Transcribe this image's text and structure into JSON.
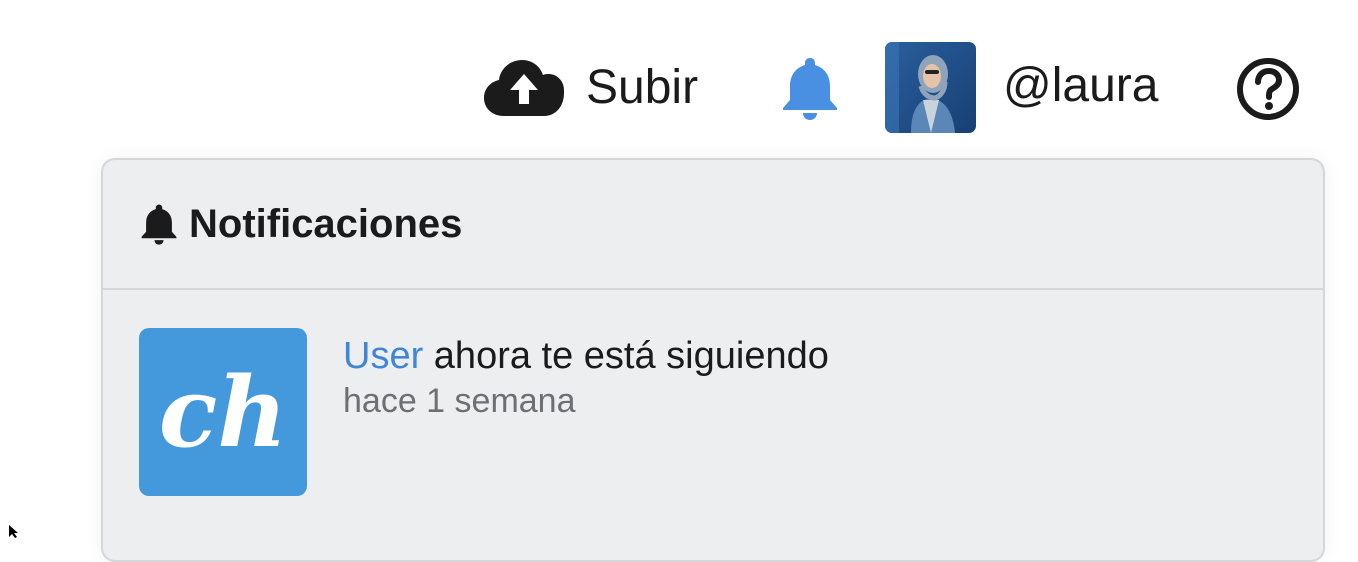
{
  "topbar": {
    "upload_label": "Subir",
    "username": "@laura",
    "icons": {
      "upload": "cloud-upload-icon",
      "notifications": "bell-icon",
      "help": "question-circle-icon"
    }
  },
  "notifications": {
    "title": "Notificaciones",
    "items": [
      {
        "user": "User",
        "message": "ahora te está siguiendo",
        "time": "hace 1 semana",
        "logo_text": "ch"
      }
    ]
  },
  "colors": {
    "accent": "#4a90e2",
    "link": "#3f86d6",
    "logo_bg": "#4499dd",
    "panel_bg": "#eceef0",
    "text": "#1b1b1b",
    "muted": "#6c6f73"
  }
}
